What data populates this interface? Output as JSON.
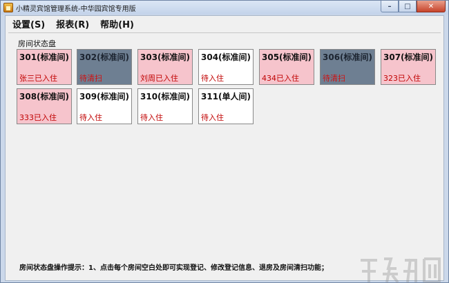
{
  "window": {
    "title": "小精灵宾馆管理系统-中华园宾馆专用版",
    "controls": {
      "minimize": "–",
      "maximize": "□",
      "close": "✕"
    }
  },
  "menu": [
    {
      "label": "设置(S)"
    },
    {
      "label": "报表(R)"
    },
    {
      "label": "帮助(H)"
    }
  ],
  "panel": {
    "title": "房间状态盘"
  },
  "rooms": [
    {
      "name": "301(标准间)",
      "status": "张三已入住",
      "state": "occupied"
    },
    {
      "name": "302(标准间)",
      "status": "待清扫",
      "state": "cleaning"
    },
    {
      "name": "303(标准间)",
      "status": "刘周已入住",
      "state": "occupied"
    },
    {
      "name": "304(标准间)",
      "status": "待入住",
      "state": "vacant"
    },
    {
      "name": "305(标准间)",
      "status": "434已入住",
      "state": "occupied"
    },
    {
      "name": "306(标准间)",
      "status": "待清扫",
      "state": "cleaning"
    },
    {
      "name": "307(标准间)",
      "status": "323已入住",
      "state": "occupied"
    },
    {
      "name": "308(标准间)",
      "status": "333已入住",
      "state": "occupied"
    },
    {
      "name": "309(标准间)",
      "status": "待入住",
      "state": "vacant"
    },
    {
      "name": "310(标准间)",
      "status": "待入住",
      "state": "vacant"
    },
    {
      "name": "311(单人间)",
      "status": "待入住",
      "state": "vacant"
    }
  ],
  "hint": "房间状态盘操作提示：1、点击每个房间空白处即可实现登记、修改登记信息、退房及房间清扫功能；",
  "colors": {
    "occupied": "#f6c4cc",
    "cleaning": "#6e7f92",
    "vacant": "#ffffff",
    "status_text": "#c00000"
  }
}
